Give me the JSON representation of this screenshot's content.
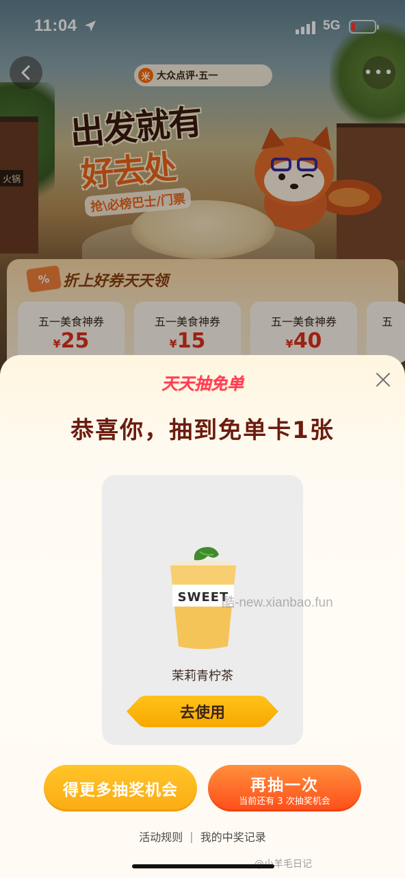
{
  "status_bar": {
    "time": "11:04",
    "network": "5G",
    "battery_level": 0.08,
    "icons": [
      "location-arrow-icon",
      "signal-icon",
      "battery-icon"
    ]
  },
  "background": {
    "brand_pill": "大众点评·五一",
    "brand_logo_glyph": "米",
    "hero_title_line1": "出发就有",
    "hero_title_line2": "好去处",
    "hero_subtitle": "抢\\必榜巴士/门票",
    "restaurant_sign": "火锅",
    "coupon_section": {
      "tag_glyph": "%",
      "heading": "折上好券天天领",
      "coupons": [
        {
          "title": "五一美食神券",
          "currency": "¥",
          "amount": "25"
        },
        {
          "title": "五一美食神券",
          "currency": "¥",
          "amount": "15"
        },
        {
          "title": "五一美食神券",
          "currency": "¥",
          "amount": "40"
        },
        {
          "title": "五",
          "currency": "",
          "amount": ""
        }
      ]
    }
  },
  "dialog": {
    "logo_text": "天天抽免单",
    "title": "恭喜你，抽到免单卡1张",
    "prize": {
      "cup_brand": "SWEET",
      "name": "茉莉青柠茶",
      "use_button": "去使用"
    },
    "buttons": {
      "more_chances": "得更多抽奖机会",
      "draw_again": "再抽一次",
      "draw_again_sub": "当前还有 3 次抽奖机会"
    },
    "footer": {
      "rules": "活动规则",
      "separator": "|",
      "records": "我的中奖记录"
    }
  },
  "watermarks": {
    "site": "酷-new.xianbao.fun",
    "weibo": "@小羊毛日记"
  },
  "colors": {
    "accent_orange": "#ff5a1f",
    "accent_yellow": "#fbb316",
    "title_brown": "#6b1c0e",
    "logo_pink": "#ff3a57"
  }
}
